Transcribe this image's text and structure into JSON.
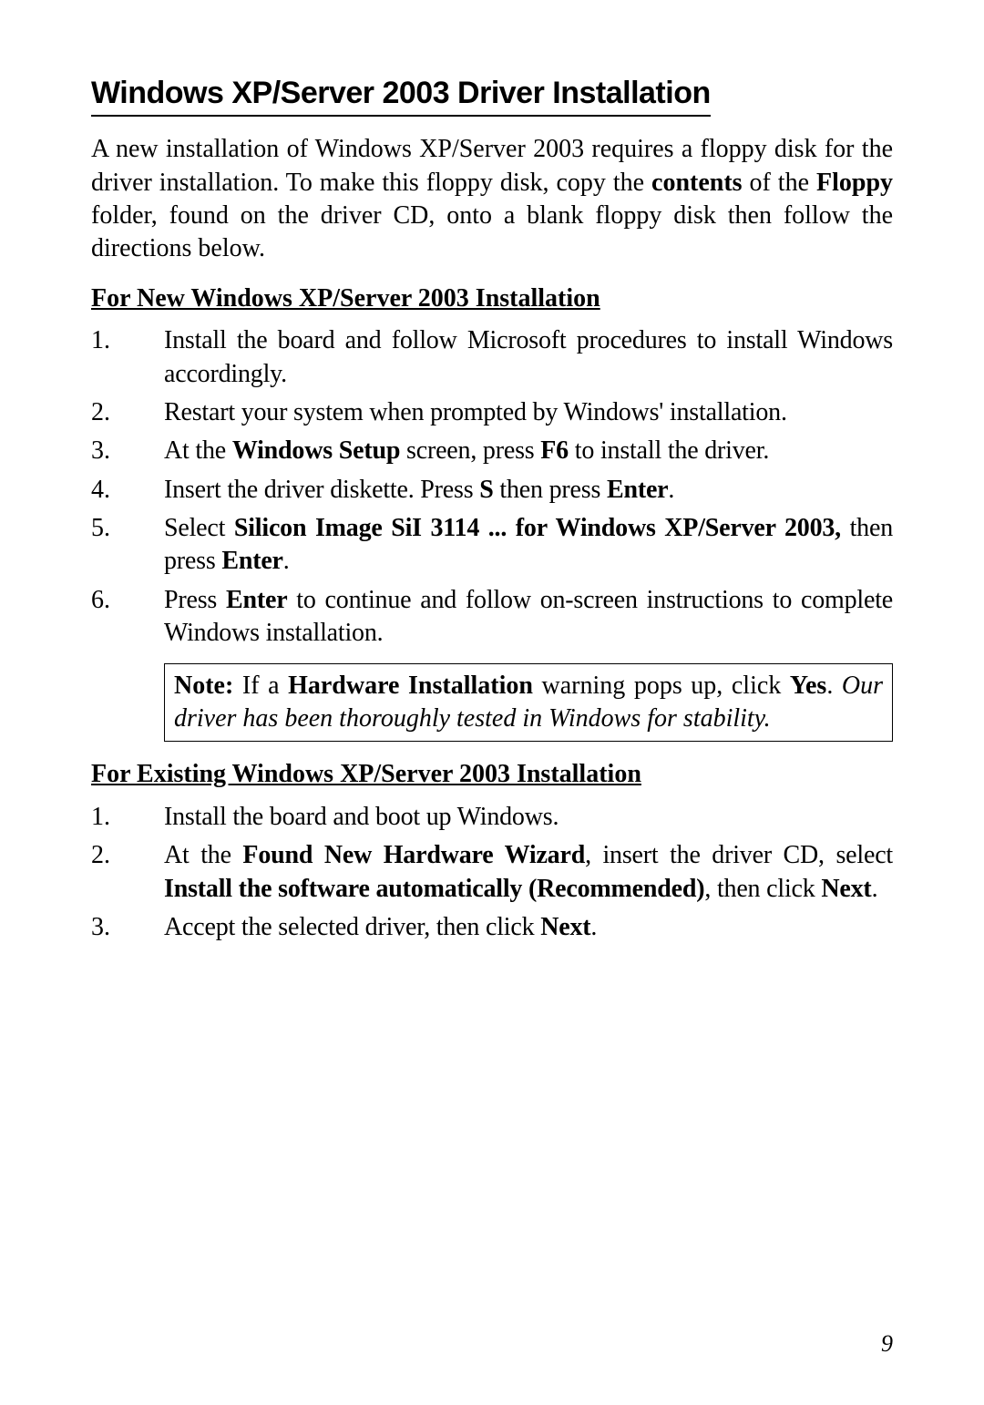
{
  "heading": "Windows XP/Server 2003 Driver Installation",
  "intro": {
    "pre": "A new installation of Windows XP/Server 2003 requires a floppy disk for the driver installation.  To make this floppy disk, copy the ",
    "b1": "contents",
    "mid": " of the ",
    "b2": "Floppy",
    "post": " folder, found on the driver CD, onto a blank floppy disk then follow the directions below."
  },
  "sectionA": {
    "title": "For New Windows XP/Server 2003 Installation",
    "items": [
      {
        "n": "1.",
        "segs": [
          {
            "t": "Install the board and follow Microsoft procedures to install Windows accordingly."
          }
        ]
      },
      {
        "n": "2.",
        "segs": [
          {
            "t": "Restart your system when prompted by Windows' installation."
          }
        ]
      },
      {
        "n": "3.",
        "segs": [
          {
            "t": "At the "
          },
          {
            "t": "Windows Setup",
            "b": true
          },
          {
            "t": " screen, press "
          },
          {
            "t": "F6",
            "b": true
          },
          {
            "t": " to install the driver."
          }
        ]
      },
      {
        "n": "4.",
        "segs": [
          {
            "t": "Insert the driver diskette. Press "
          },
          {
            "t": "S",
            "b": true
          },
          {
            "t": " then press "
          },
          {
            "t": "Enter",
            "b": true
          },
          {
            "t": "."
          }
        ]
      },
      {
        "n": "5.",
        "segs": [
          {
            "t": "Select "
          },
          {
            "t": "Silicon Image SiI 3114 ... for Windows XP/Server 2003,",
            "b": true
          },
          {
            "t": " then press "
          },
          {
            "t": "Enter",
            "b": true
          },
          {
            "t": "."
          }
        ]
      },
      {
        "n": "6.",
        "segs": [
          {
            "t": "Press "
          },
          {
            "t": "Enter",
            "b": true
          },
          {
            "t": " to continue and follow on-screen instructions to complete Windows installation."
          }
        ]
      }
    ]
  },
  "note": {
    "lead": "Note:",
    "afterLead": "  If a ",
    "b1": "Hardware Installation",
    "mid": " warning pops up, click ",
    "b2": "Yes",
    "afterYes": ".   ",
    "italic": "Our driver has been thoroughly tested in Windows for stability."
  },
  "sectionB": {
    "title": "For Existing Windows XP/Server 2003 Installation",
    "items": [
      {
        "n": "1.",
        "segs": [
          {
            "t": "Install the board and boot up Windows."
          }
        ]
      },
      {
        "n": "2.",
        "segs": [
          {
            "t": "At the "
          },
          {
            "t": "Found New Hardware Wizard",
            "b": true
          },
          {
            "t": ", insert the driver CD, select "
          },
          {
            "t": "Install the software automatically (Recommended)",
            "b": true
          },
          {
            "t": ", then click "
          },
          {
            "t": "Next",
            "b": true
          },
          {
            "t": "."
          }
        ]
      },
      {
        "n": "3.",
        "segs": [
          {
            "t": "Accept the selected driver, then click "
          },
          {
            "t": "Next",
            "b": true
          },
          {
            "t": "."
          }
        ]
      }
    ]
  },
  "pageNumber": "9"
}
